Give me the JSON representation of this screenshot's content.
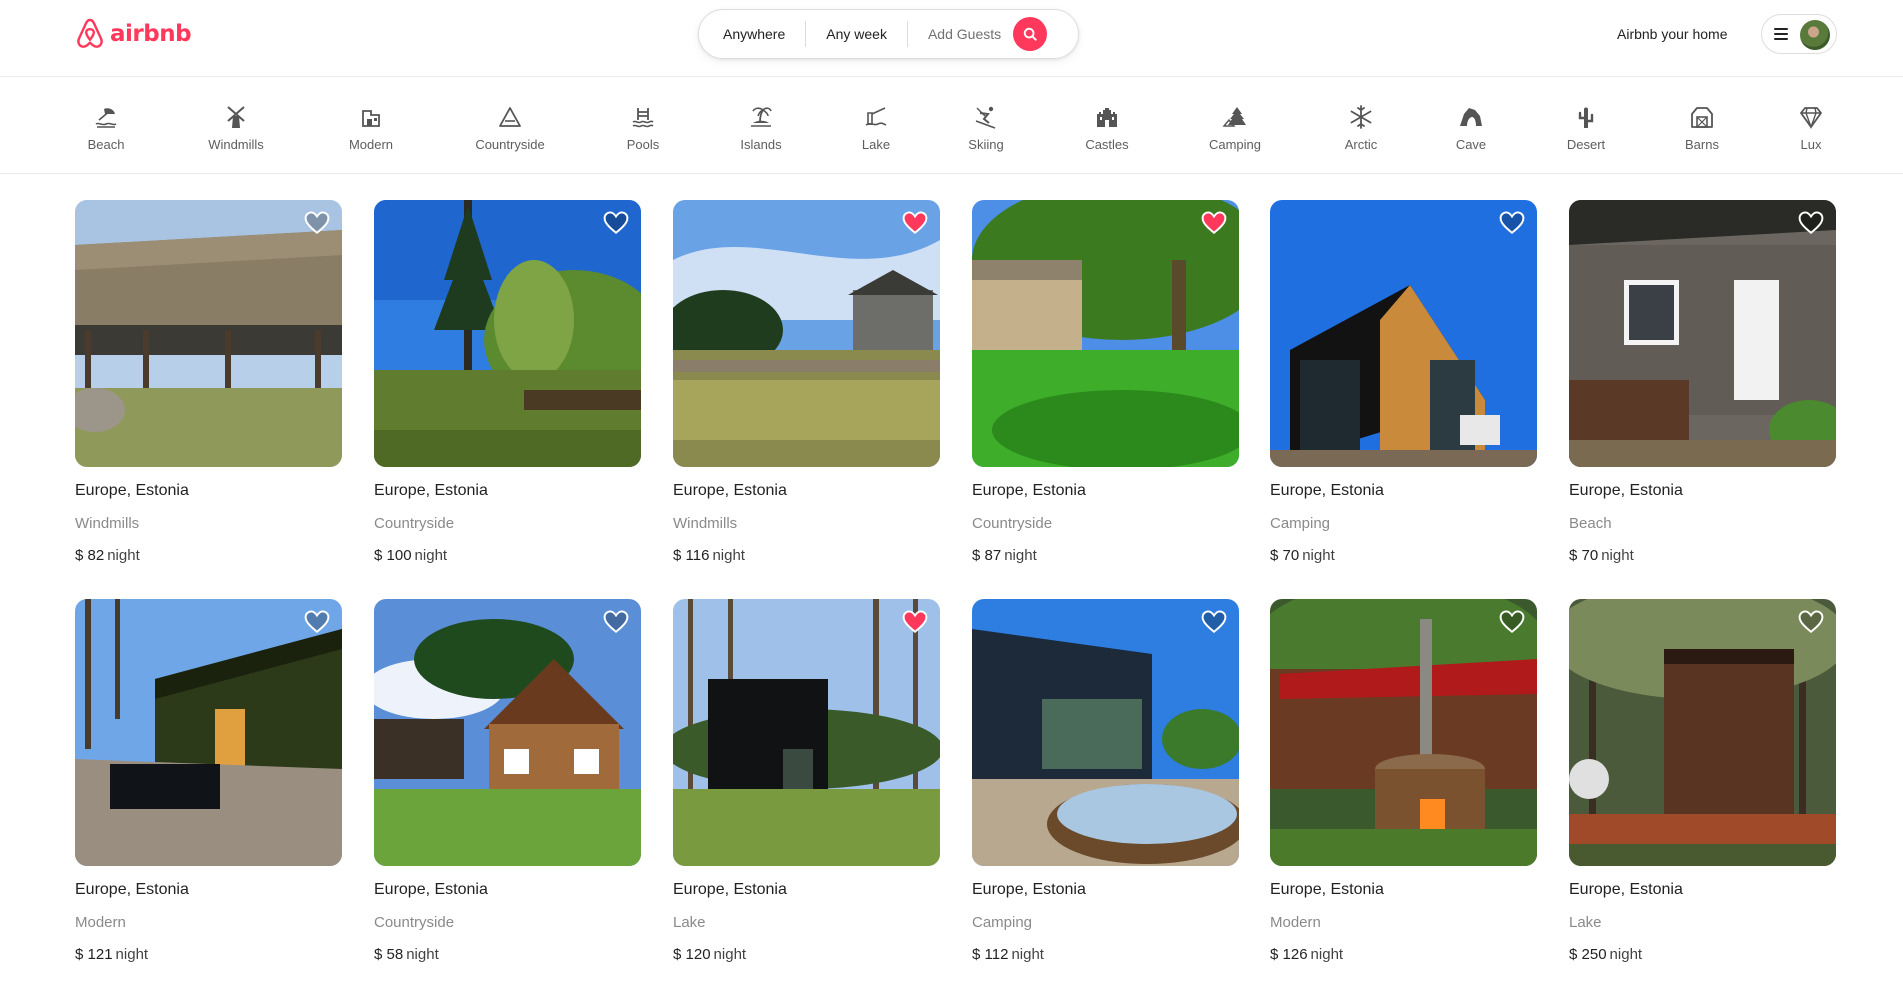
{
  "header": {
    "logo_text": "airbnb",
    "search": {
      "where": "Anywhere",
      "when": "Any week",
      "guests": "Add Guests"
    },
    "host_link": "Airbnb your home"
  },
  "categories": [
    {
      "label": "Beach",
      "icon": "beach-icon"
    },
    {
      "label": "Windmills",
      "icon": "windmill-icon"
    },
    {
      "label": "Modern",
      "icon": "modern-house-icon"
    },
    {
      "label": "Countryside",
      "icon": "countryside-icon"
    },
    {
      "label": "Pools",
      "icon": "pool-icon"
    },
    {
      "label": "Islands",
      "icon": "island-icon"
    },
    {
      "label": "Lake",
      "icon": "lake-icon"
    },
    {
      "label": "Skiing",
      "icon": "skiing-icon"
    },
    {
      "label": "Castles",
      "icon": "castle-icon"
    },
    {
      "label": "Camping",
      "icon": "camping-icon"
    },
    {
      "label": "Arctic",
      "icon": "snowflake-icon"
    },
    {
      "label": "Cave",
      "icon": "cave-icon"
    },
    {
      "label": "Desert",
      "icon": "cactus-icon"
    },
    {
      "label": "Barns",
      "icon": "barn-icon"
    },
    {
      "label": "Lux",
      "icon": "diamond-icon"
    }
  ],
  "listings": [
    {
      "location": "Europe, Estonia",
      "type": "Windmills",
      "currency": "$",
      "price": "82",
      "unit": "night",
      "favorited": false
    },
    {
      "location": "Europe, Estonia",
      "type": "Countryside",
      "currency": "$",
      "price": "100",
      "unit": "night",
      "favorited": false
    },
    {
      "location": "Europe, Estonia",
      "type": "Windmills",
      "currency": "$",
      "price": "116",
      "unit": "night",
      "favorited": true
    },
    {
      "location": "Europe, Estonia",
      "type": "Countryside",
      "currency": "$",
      "price": "87",
      "unit": "night",
      "favorited": true
    },
    {
      "location": "Europe, Estonia",
      "type": "Camping",
      "currency": "$",
      "price": "70",
      "unit": "night",
      "favorited": false
    },
    {
      "location": "Europe, Estonia",
      "type": "Beach",
      "currency": "$",
      "price": "70",
      "unit": "night",
      "favorited": false
    },
    {
      "location": "Europe, Estonia",
      "type": "Modern",
      "currency": "$",
      "price": "121",
      "unit": "night",
      "favorited": false
    },
    {
      "location": "Europe, Estonia",
      "type": "Countryside",
      "currency": "$",
      "price": "58",
      "unit": "night",
      "favorited": false
    },
    {
      "location": "Europe, Estonia",
      "type": "Lake",
      "currency": "$",
      "price": "120",
      "unit": "night",
      "favorited": true
    },
    {
      "location": "Europe, Estonia",
      "type": "Camping",
      "currency": "$",
      "price": "112",
      "unit": "night",
      "favorited": false
    },
    {
      "location": "Europe, Estonia",
      "type": "Modern",
      "currency": "$",
      "price": "126",
      "unit": "night",
      "favorited": false
    },
    {
      "location": "Europe, Estonia",
      "type": "Lake",
      "currency": "$",
      "price": "250",
      "unit": "night",
      "favorited": false
    }
  ],
  "colors": {
    "brand": "#ff385c",
    "favorite_active": "#ff385c",
    "text": "#222222",
    "muted": "#717171"
  }
}
